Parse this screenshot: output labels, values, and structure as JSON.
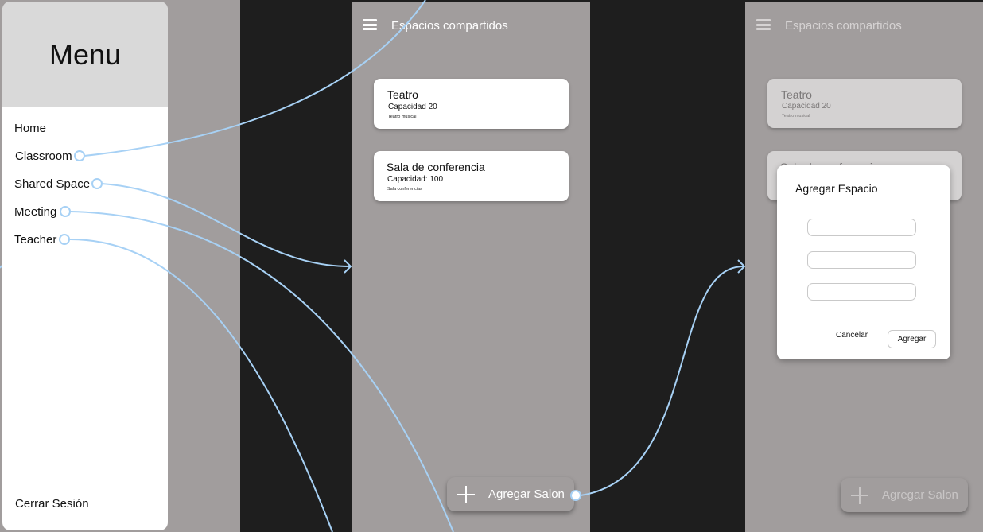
{
  "menu": {
    "title": "Menu",
    "items": [
      {
        "label": "Home"
      },
      {
        "label": "Classroom"
      },
      {
        "label": "Shared Space"
      },
      {
        "label": "Meeting"
      },
      {
        "label": "Teacher"
      }
    ],
    "logout": "Cerrar Sesión"
  },
  "list_screen": {
    "title": "Espacios compartidos",
    "cards": [
      {
        "name": "Teatro",
        "capacity": "Capacidad 20",
        "description": "Teatro musical"
      },
      {
        "name": "Sala de conferencia",
        "capacity": "Capacidad: 100",
        "description": "Sala conferencias"
      }
    ],
    "fab_label": "Agregar Salon"
  },
  "dialog_screen": {
    "title": "Espacios compartidos",
    "cards": [
      {
        "name": "Teatro",
        "capacity": "Capacidad 20",
        "description": "Teatro musical"
      },
      {
        "name": "Sala de conferencia"
      }
    ],
    "fab_label": "Agregar Salon",
    "dialog": {
      "title": "Agregar Espacio",
      "fields": [
        {
          "value": "",
          "placeholder": ""
        },
        {
          "value": "",
          "placeholder": ""
        },
        {
          "value": "",
          "placeholder": ""
        }
      ],
      "cancel_label": "Cancelar",
      "confirm_label": "Agregar"
    }
  },
  "colors": {
    "canvas": "#1e1e1e",
    "frame": "#a19d9d",
    "drawer_header": "#d9d9d9",
    "connector": "#a7d1f5"
  },
  "icons": [
    "menu-icon",
    "plus-icon",
    "connector-node-icon",
    "arrow-head-icon"
  ]
}
